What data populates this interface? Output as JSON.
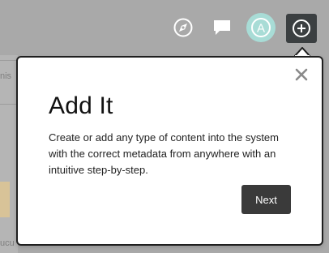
{
  "header": {
    "icons": [
      "compass-icon",
      "chat-icon",
      "avatar-icon",
      "add-icon"
    ],
    "avatar_letter": "A"
  },
  "background": {
    "text_fragments": [
      "nis",
      "ucu"
    ]
  },
  "popover": {
    "title": "Add It",
    "body": "Create or add any type of content into the system with the correct metadata from anywhere with an intuitive step-by-step.",
    "next_label": "Next",
    "close_icon": "close-icon"
  },
  "colors": {
    "overlay": "#a9a9a9",
    "add_button": "#3b3f41",
    "avatar": "#a8dcd6",
    "next_button": "#3a3a3a"
  }
}
